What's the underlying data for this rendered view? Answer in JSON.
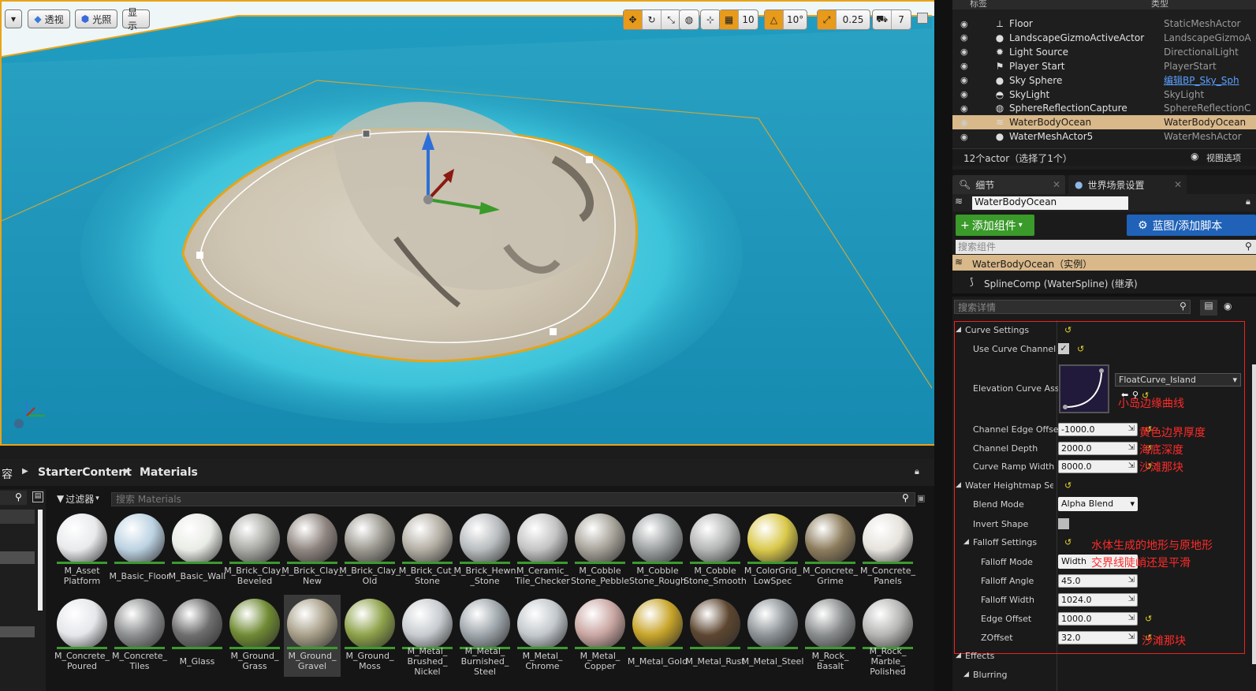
{
  "viewport": {
    "btn_perspective": "透视",
    "btn_lit": "光照",
    "btn_show": "显示",
    "grid_snap": "10",
    "rot_snap": "10°",
    "scale_snap": "0.25",
    "camera_speed": "7"
  },
  "outliner": {
    "col_label": "标签",
    "col_type": "类型",
    "rows": [
      {
        "name": "Floor",
        "type": "StaticMeshActor",
        "icon": "static-mesh-icon"
      },
      {
        "name": "LandscapeGizmoActiveActor",
        "type": "LandscapeGizmoA",
        "icon": "sphere-icon"
      },
      {
        "name": "Light Source",
        "type": "DirectionalLight",
        "icon": "sun-icon"
      },
      {
        "name": "Player Start",
        "type": "PlayerStart",
        "icon": "player-start-icon"
      },
      {
        "name": "Sky Sphere",
        "type": "编辑BP_Sky_Sph",
        "icon": "sphere-icon"
      },
      {
        "name": "SkyLight",
        "type": "SkyLight",
        "icon": "skylight-icon"
      },
      {
        "name": "SphereReflectionCapture",
        "type": "SphereReflectionC",
        "icon": "reflection-icon"
      },
      {
        "name": "WaterBodyOcean",
        "type": "WaterBodyOcean",
        "icon": "water-icon"
      },
      {
        "name": "WaterMeshActor5",
        "type": "WaterMeshActor",
        "icon": "sphere-icon"
      }
    ],
    "status": "12个actor（选择了1个）",
    "view_options": "视图选项"
  },
  "details": {
    "tab_details": "细节",
    "tab_world": "世界场景设置",
    "actor_name": "WaterBodyOcean",
    "add_component": "添加组件",
    "blueprint": "蓝图/添加脚本",
    "search_components": "搜索组件",
    "instance_row": "WaterBodyOcean（实例）",
    "spline_row": "SplineComp (WaterSpline) (继承)",
    "search_details": "搜索详情",
    "curve_settings": "Curve Settings",
    "use_curve_channel": "Use Curve Channel",
    "elevation_curve": "Elevation Curve Asse",
    "curve_asset": "FloatCurve_Island",
    "channel_edge_offset": "Channel Edge Offset",
    "channel_edge_offset_val": "-1000.0",
    "channel_depth": "Channel Depth",
    "channel_depth_val": "2000.0",
    "curve_ramp_width": "Curve Ramp Width",
    "curve_ramp_width_val": "8000.0",
    "heightmap_settings": "Water Heightmap Setti",
    "blend_mode": "Blend Mode",
    "blend_mode_val": "Alpha Blend",
    "invert_shape": "Invert Shape",
    "falloff_settings": "Falloff Settings",
    "falloff_mode": "Falloff Mode",
    "falloff_mode_val": "Width",
    "falloff_angle": "Falloff Angle",
    "falloff_angle_val": "45.0",
    "falloff_width": "Falloff Width",
    "falloff_width_val": "1024.0",
    "edge_offset": "Edge Offset",
    "edge_offset_val": "1000.0",
    "zoffset": "ZOffset",
    "zoffset_val": "32.0",
    "effects": "Effects",
    "blurring": "Blurring"
  },
  "annotations": {
    "a1": "小岛边缘曲线",
    "a2": "黄色边界厚度",
    "a3": "海底深度",
    "a4": "沙滩那块",
    "a5": "水体生成的地形与原地形",
    "a6": "交界线陡峭还是平滑",
    "a7": "沙滩那块"
  },
  "content": {
    "breadcrumb_prefix": "容",
    "crumb1": "StarterContent",
    "crumb2": "Materials",
    "filter": "过滤器",
    "search_placeholder": "搜索 Materials",
    "row1": [
      {
        "l1": "M_Asset",
        "l2": "Platform",
        "c": "#e8eaec"
      },
      {
        "l1": "M_Basic_Floor",
        "l2": "",
        "c": "#bcd2e2"
      },
      {
        "l1": "M_Basic_Wall",
        "l2": "",
        "c": "#e9ece6"
      },
      {
        "l1": "M_Brick_Clay_",
        "l2": "Beveled",
        "c": "#a8a8a4"
      },
      {
        "l1": "M_Brick_Clay_",
        "l2": "New",
        "c": "#8f8580"
      },
      {
        "l1": "M_Brick_Clay_",
        "l2": "Old",
        "c": "#9b9890"
      },
      {
        "l1": "M_Brick_Cut_",
        "l2": "Stone",
        "c": "#b3aea4"
      },
      {
        "l1": "M_Brick_Hewn",
        "l2": "_Stone",
        "c": "#b8bcbe"
      },
      {
        "l1": "M_Ceramic_",
        "l2": "Tile_Checker",
        "c": "#c4c4c4"
      },
      {
        "l1": "M_Cobble",
        "l2": "Stone_Pebble",
        "c": "#a7a39a"
      },
      {
        "l1": "M_Cobble",
        "l2": "Stone_Rough",
        "c": "#9da1a2"
      },
      {
        "l1": "M_Cobble",
        "l2": "Stone_Smooth",
        "c": "#b2b5b3"
      },
      {
        "l1": "M_ColorGrid_",
        "l2": "LowSpec",
        "c": "#d9c84a"
      },
      {
        "l1": "M_Concrete_",
        "l2": "Grime",
        "c": "#8c7c5c"
      },
      {
        "l1": "M_Concrete_",
        "l2": "Panels",
        "c": "#e6e3dd"
      }
    ],
    "row2": [
      {
        "l1": "M_Concrete_",
        "l2": "Poured",
        "c": "#e5e7ea"
      },
      {
        "l1": "M_Concrete_",
        "l2": "Tiles",
        "c": "#8d8f90"
      },
      {
        "l1": "M_Glass",
        "l2": "",
        "c": "#6e6e6e"
      },
      {
        "l1": "M_Ground_",
        "l2": "Grass",
        "c": "#6f8a33"
      },
      {
        "l1": "M_Ground_",
        "l2": "Gravel",
        "c": "#a9a08a"
      },
      {
        "l1": "M_Ground_",
        "l2": "Moss",
        "c": "#8ea24a"
      },
      {
        "l1": "M_Metal_",
        "l2": "Brushed_",
        "l3": "Nickel",
        "c": "#c8ccd0"
      },
      {
        "l1": "M_Metal_",
        "l2": "Burnished_",
        "l3": "Steel",
        "c": "#9ea6ab"
      },
      {
        "l1": "M_Metal_",
        "l2": "Chrome",
        "c": "#c3c8cc"
      },
      {
        "l1": "M_Metal_",
        "l2": "Copper",
        "c": "#c9a6a2"
      },
      {
        "l1": "M_Metal_Gold",
        "l2": "",
        "c": "#c7a429"
      },
      {
        "l1": "M_Metal_Rust",
        "l2": "",
        "c": "#5d4630"
      },
      {
        "l1": "M_Metal_Steel",
        "l2": "",
        "c": "#8d9397"
      },
      {
        "l1": "M_Rock_",
        "l2": "Basalt",
        "c": "#8a8d8e"
      },
      {
        "l1": "M_Rock_",
        "l2": "Marble_",
        "l3": "Polished",
        "c": "#b5b6b3"
      }
    ]
  }
}
